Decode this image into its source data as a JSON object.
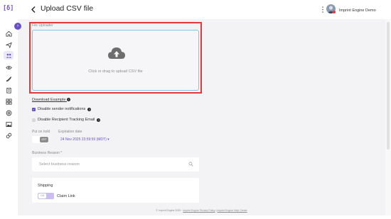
{
  "app": {
    "logo_text": "[δ]"
  },
  "header": {
    "title": "Upload CSV file",
    "user_name": "Imprint Engine Demo"
  },
  "sidebar": {
    "items": [
      {
        "icon": "home-icon",
        "active": false
      },
      {
        "icon": "send-icon",
        "active": false
      },
      {
        "icon": "team-icon",
        "active": true
      },
      {
        "icon": "eye-icon",
        "active": false
      },
      {
        "icon": "rocket-icon",
        "active": false
      },
      {
        "icon": "clipboard-icon",
        "active": false
      },
      {
        "icon": "grid-icon",
        "active": false
      },
      {
        "icon": "target-icon",
        "active": false
      },
      {
        "icon": "image-icon",
        "active": false
      },
      {
        "icon": "link-icon",
        "active": false
      }
    ]
  },
  "form": {
    "file_uploader_label": "File Uploader",
    "dropzone_text": "Click or drag to upload CSV file",
    "download_example": "Download Example",
    "disable_sender_notifications": "Disable sender notifications",
    "disable_recipient_tracking_email": "Disable Recipient Tracking Email",
    "put_on_hold_label": "Put on hold",
    "put_on_hold_value": "OFF",
    "expiration_date_label": "Expiration date",
    "expiration_date_value": "24 Nov 2025 23:59:59 (MDT) ▾",
    "business_reason_label": "Business Reason *",
    "business_reason_placeholder": "Select business reason",
    "shipping_title": "Shipping",
    "claim_link_toggle": "ON",
    "claim_link_label": "Claim Link"
  },
  "footer": {
    "copyright": "© Imprint Engine 2025 ·",
    "privacy": "Imprint Engine Privacy Policy",
    "separator": " | ",
    "help": "Imprint Engine Help Center"
  },
  "colors": {
    "accent": "#6b4fc8",
    "highlight_border": "#e53935",
    "dropzone_border": "#7ec7e6"
  }
}
